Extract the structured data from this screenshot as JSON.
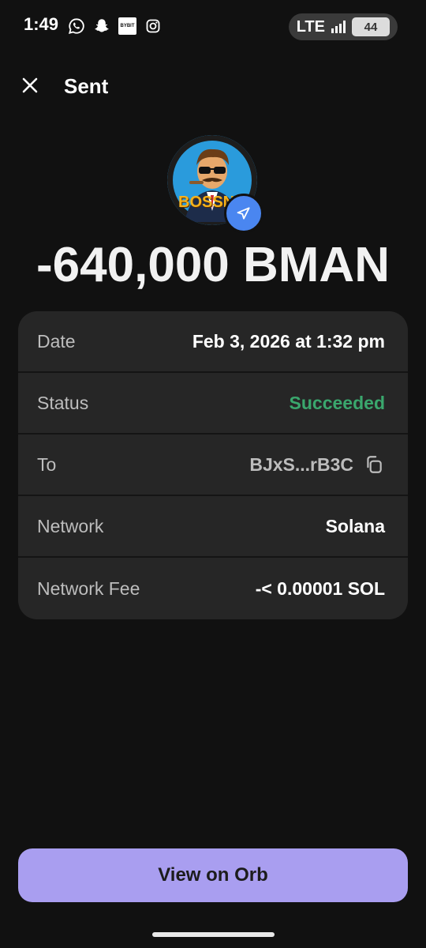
{
  "status_bar": {
    "time": "1:49",
    "bybit_label": "BYBIT",
    "network": "LTE",
    "battery": "44"
  },
  "header": {
    "title": "Sent"
  },
  "avatar": {
    "token_text": "BOSSN"
  },
  "amount": "-640,000 BMAN",
  "details": [
    {
      "label": "Date",
      "value": "Feb 3, 2026 at 1:32 pm"
    },
    {
      "label": "Status",
      "value": "Succeeded"
    },
    {
      "label": "To",
      "value": "BJxS...rB3C"
    },
    {
      "label": "Network",
      "value": "Solana"
    },
    {
      "label": "Network Fee",
      "value": "-< 0.00001 SOL"
    }
  ],
  "primary_button": "View on Orb",
  "colors": {
    "background": "#111111",
    "card": "#262626",
    "success": "#3aa76d",
    "button": "#a99ef0",
    "badge": "#4a86f0"
  }
}
